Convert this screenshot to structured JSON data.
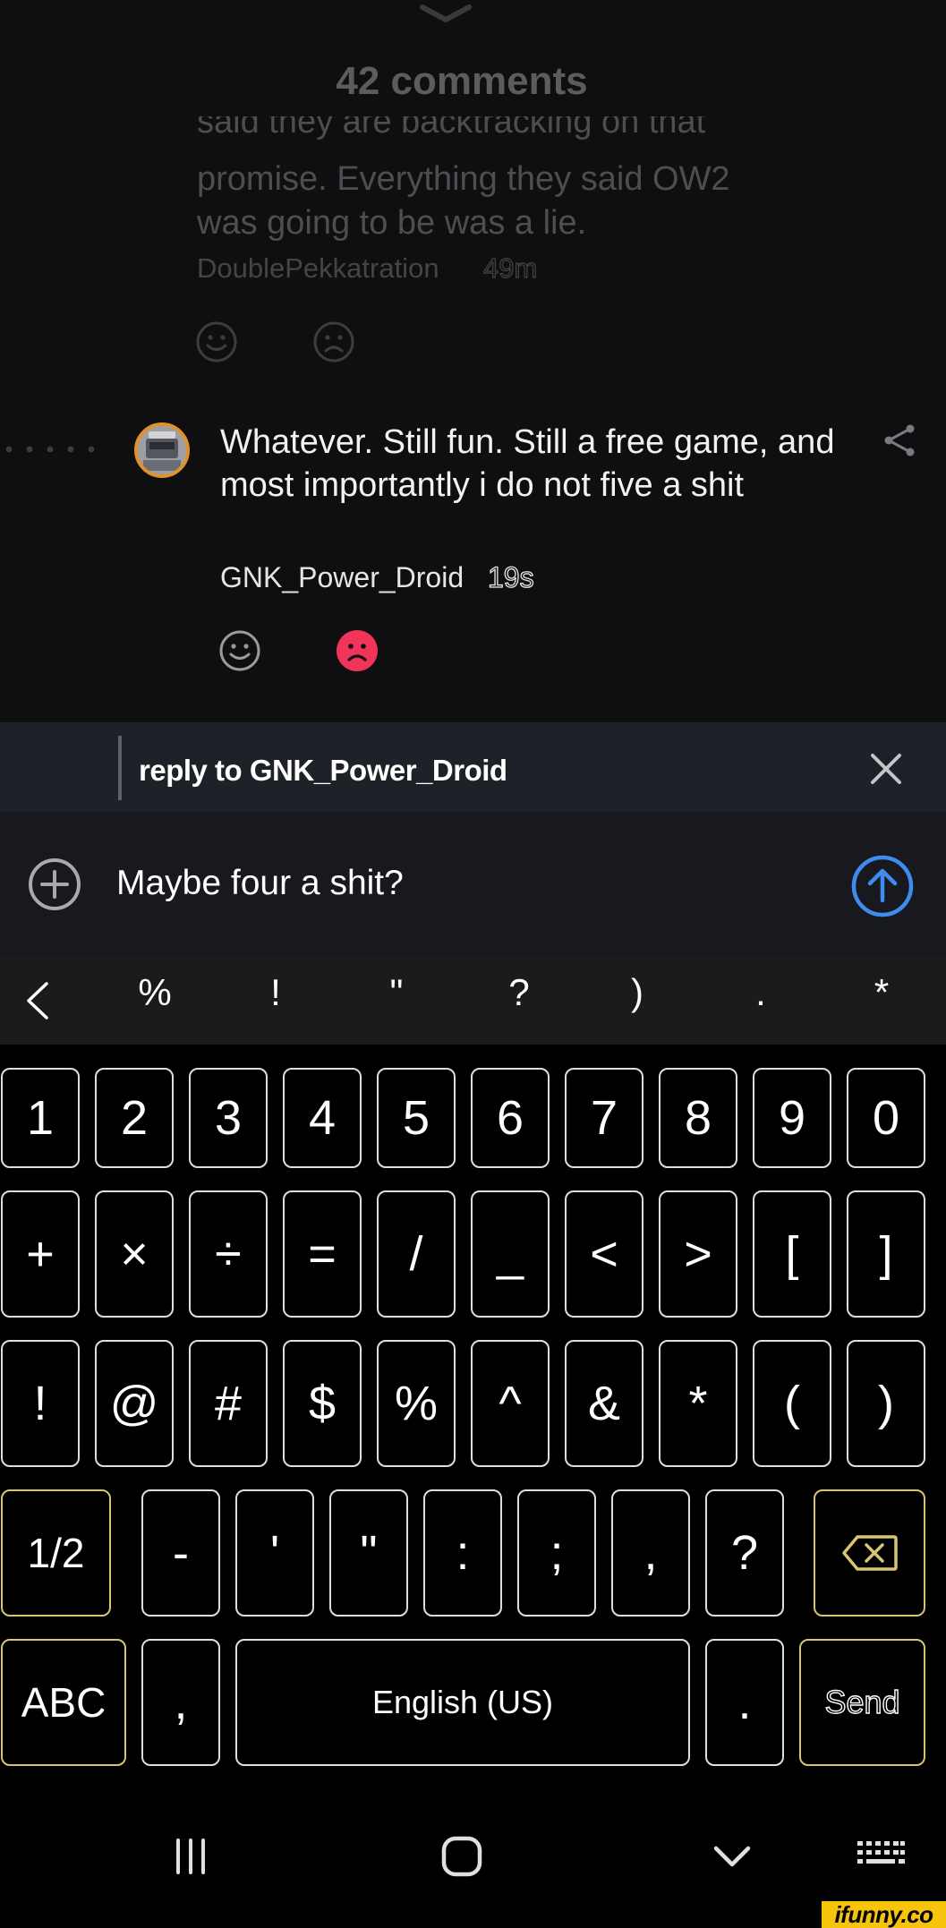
{
  "header": {
    "comments_count_label": "42 comments"
  },
  "previous_comment": {
    "line1": "said they are backtracking on that",
    "line2": "promise. Everything they said OW2",
    "line3": "was going to be was a lie.",
    "author": "DoublePekkatration",
    "time": "49m"
  },
  "comment": {
    "text": "Whatever. Still fun. Still a free game, and most importantly i do not five a shit",
    "author": "GNK_Power_Droid",
    "time": "19s",
    "unsmile_active_color": "#f0345a",
    "avatar_ring_color": "#e0922a"
  },
  "reply_bar": {
    "label": "reply to GNK_Power_Droid"
  },
  "composer": {
    "value": "Maybe four a shit?",
    "send_color": "#3f8cf0"
  },
  "symbol_row": [
    "%",
    "!",
    "\"",
    "?",
    ")",
    ".",
    "*"
  ],
  "keyboard": {
    "row1": [
      "1",
      "2",
      "3",
      "4",
      "5",
      "6",
      "7",
      "8",
      "9",
      "0"
    ],
    "row2": [
      "+",
      "×",
      "÷",
      "=",
      "/",
      "_",
      "<",
      ">",
      "[",
      "]"
    ],
    "row3": [
      "!",
      "@",
      "#",
      "$",
      "%",
      "^",
      "&",
      "*",
      "(",
      ")"
    ],
    "row4": {
      "page_toggle": "1/2",
      "keys": [
        "-",
        "'",
        "\"",
        ":",
        ";",
        ",",
        "?"
      ]
    },
    "row5": {
      "abc": "ABC",
      "comma": ",",
      "space": "English (US)",
      "period": ".",
      "send": "Send"
    },
    "function_key_color": "#d8c56e"
  },
  "watermark": "ifunny.co"
}
